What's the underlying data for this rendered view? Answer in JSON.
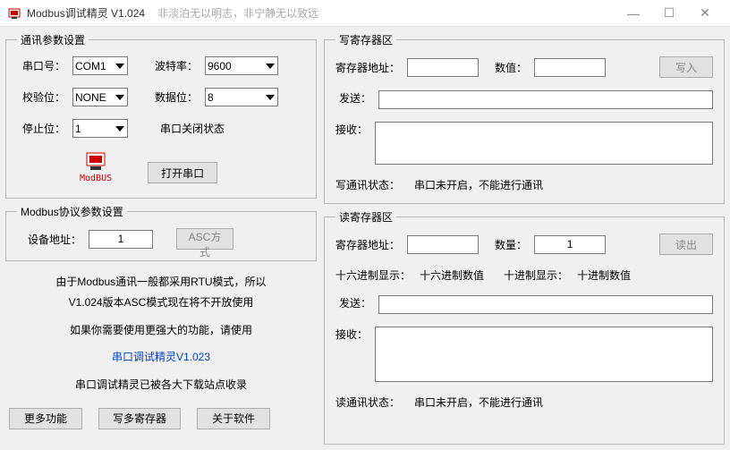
{
  "app": {
    "title": "Modbus调试精灵 V1.024",
    "subtitle": "非淡泊无以明志，非宁静无以致远"
  },
  "winbtn": {
    "min": "—",
    "max": "☐",
    "close": "✕"
  },
  "comm": {
    "legend": "通讯参数设置",
    "port_label": "串口号：",
    "port_value": "COM1",
    "baud_label": "波特率：",
    "baud_value": "9600",
    "parity_label": "校验位：",
    "parity_value": "NONE",
    "data_label": "数据位：",
    "data_value": "8",
    "stop_label": "停止位：",
    "stop_value": "1",
    "status": "串口关闭状态",
    "open_btn": "打开串口",
    "icon_label": "ModBUS"
  },
  "proto": {
    "legend": "Modbus协议参数设置",
    "dev_label": "设备地址：",
    "dev_value": "1",
    "asc_btn": "ASC方式"
  },
  "note": {
    "line1": "由于Modbus通讯一般都采用RTU模式，所以",
    "line2": "V1.024版本ASC模式现在将不开放使用",
    "line3": "如果你需要使用更强大的功能，请使用",
    "link": "串口调试精灵V1.023",
    "line5": "串口调试精灵已被各大下载站点收录"
  },
  "btns": {
    "more": "更多功能",
    "multi": "写多寄存器",
    "about": "关于软件"
  },
  "write": {
    "legend": "写寄存器区",
    "addr_label": "寄存器地址：",
    "addr_value": "",
    "val_label": "数值：",
    "val_value": "",
    "write_btn": "写入",
    "send_label": "发送：",
    "send_value": "",
    "recv_label": "接收：",
    "recv_value": "",
    "status_label": "写通讯状态：",
    "status_text": "串口未开启，不能进行通讯"
  },
  "read": {
    "legend": "读寄存器区",
    "addr_label": "寄存器地址：",
    "addr_value": "",
    "count_label": "数量：",
    "count_value": "1",
    "read_btn": "读出",
    "hex_lbl": "十六进制显示：",
    "hex_val": "十六进制数值",
    "dec_lbl": "十进制显示：",
    "dec_val": "十进制数值",
    "send_label": "发送：",
    "send_value": "",
    "recv_label": "接收：",
    "recv_value": "",
    "status_label": "读通讯状态：",
    "status_text": "串口未开启，不能进行通讯"
  }
}
